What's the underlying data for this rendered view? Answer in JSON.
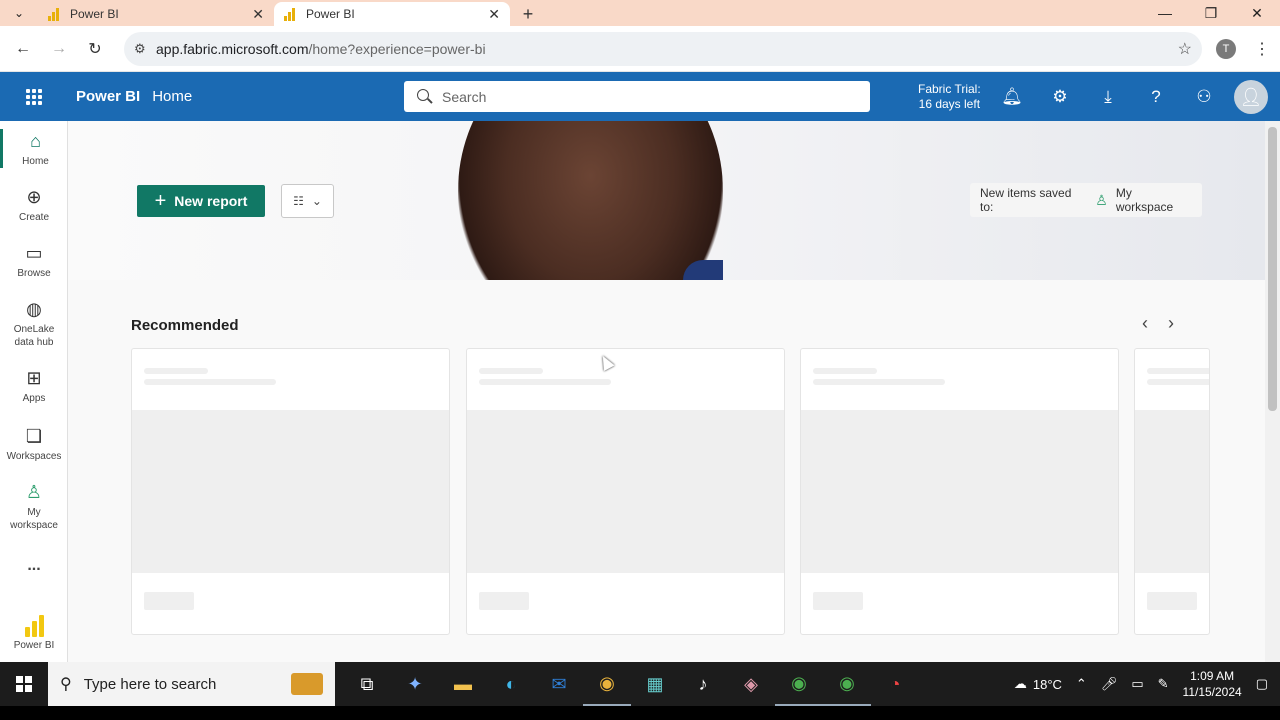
{
  "browser": {
    "tabs": [
      {
        "title": "Power BI",
        "active": false
      },
      {
        "title": "Power BI",
        "active": true
      }
    ],
    "address": {
      "host": "app.fabric.microsoft.com",
      "path": "/home?experience=power-bi"
    },
    "profile_initial": "T"
  },
  "header": {
    "brand": "Power BI",
    "breadcrumb": "Home",
    "search_placeholder": "Search",
    "trial_line1": "Fabric Trial:",
    "trial_line2": "16 days left"
  },
  "leftnav": {
    "items": [
      {
        "label": "Home",
        "icon": "home-icon"
      },
      {
        "label": "Create",
        "icon": "plus-circle-icon"
      },
      {
        "label": "Browse",
        "icon": "folder-icon"
      },
      {
        "label": "OneLake data hub",
        "icon": "onelake-icon"
      },
      {
        "label": "Apps",
        "icon": "apps-icon"
      },
      {
        "label": "Workspaces",
        "icon": "workspaces-icon"
      },
      {
        "label": "My workspace",
        "icon": "person-icon"
      },
      {
        "label": "Power BI",
        "icon": "powerbi-logo-icon"
      }
    ],
    "more": "..."
  },
  "main": {
    "new_report": "New report",
    "saved_to_label": "New items saved to:",
    "saved_to_workspace": "My workspace",
    "recommended_title": "Recommended"
  },
  "taskbar": {
    "search_placeholder": "Type here to search",
    "temperature": "18°C",
    "time": "1:09 AM",
    "date": "11/15/2024"
  },
  "colors": {
    "header_blue": "#1b6ab3",
    "accent_green": "#117865",
    "tab_strip": "#f9d9c8"
  }
}
